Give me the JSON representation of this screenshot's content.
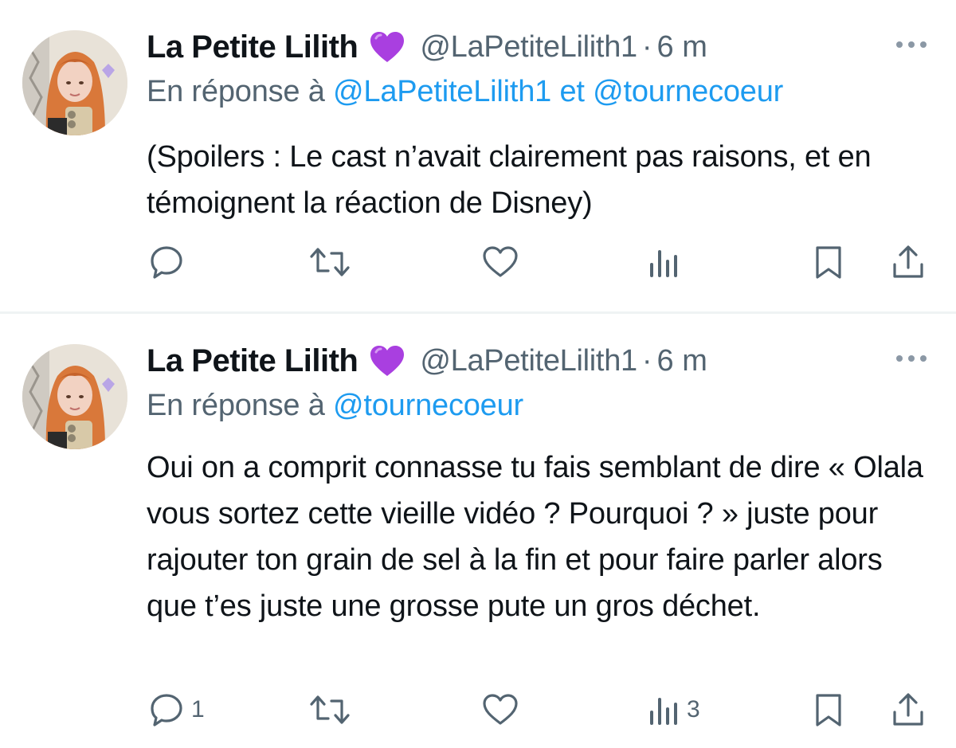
{
  "colors": {
    "text": "#0f1419",
    "secondary": "#536471",
    "mention": "#1d9bf0",
    "heart": "#a93fe0",
    "divider": "#eff3f4"
  },
  "icons": {
    "verified_emoji": "purple-heart-icon",
    "more": "more-dots-icon",
    "reply": "reply-icon",
    "retweet": "retweet-icon",
    "like": "like-icon",
    "views": "views-icon",
    "bookmark": "bookmark-icon",
    "share": "share-icon"
  },
  "tweets": [
    {
      "author_name": "La Petite Lilith",
      "handle": "@LaPetiteLilith1",
      "separator": "·",
      "time": "6 m",
      "reply_prefix": "En réponse à",
      "reply_mention_1": "@LaPetiteLilith1",
      "reply_joiner": "et",
      "reply_mention_2": "@tournecoeur",
      "text": "(Spoilers : Le cast n’avait clairement pas raisons, et en témoignent la réaction de Disney)",
      "reply_count": "",
      "view_count": ""
    },
    {
      "author_name": "La Petite Lilith",
      "handle": "@LaPetiteLilith1",
      "separator": "·",
      "time": "6 m",
      "reply_prefix": "En réponse à",
      "reply_mention_1": "@tournecoeur",
      "text": "Oui on a comprit connasse tu fais semblant de dire « Olala vous sortez cette vieille vidéo ? Pourquoi ? » juste pour rajouter ton grain de sel à la fin et pour faire parler alors que t’es juste une grosse pute un gros déchet.",
      "reply_count": "1",
      "view_count": "3"
    }
  ]
}
